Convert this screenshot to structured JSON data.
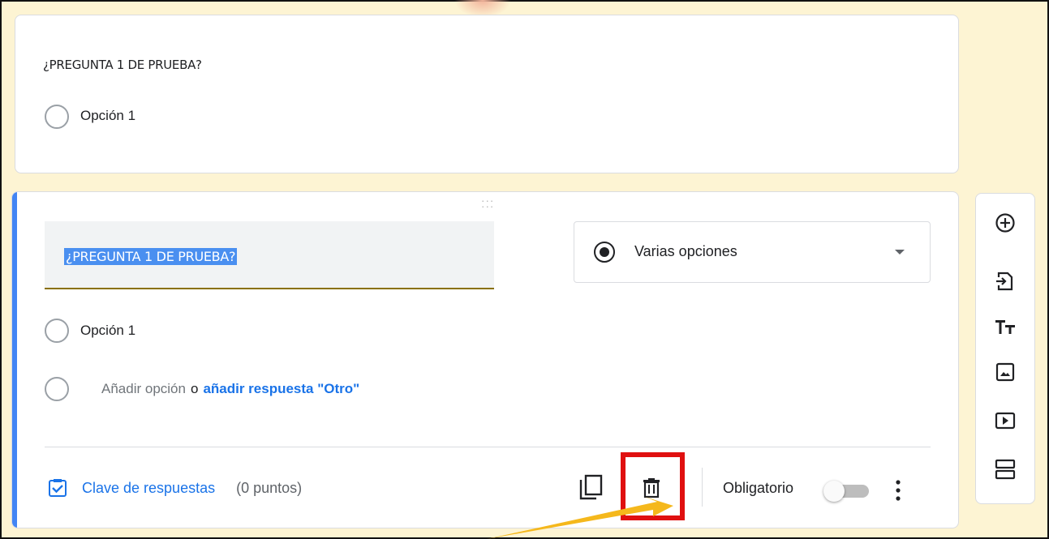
{
  "card1": {
    "question_title": "¿PREGUNTA 1 DE PRUEBA?",
    "option1": "Opción 1"
  },
  "card2": {
    "question_title": "¿PREGUNTA 1 DE PRUEBA?",
    "question_type": "Varias opciones",
    "option1": "Opción 1",
    "add_option": "Añadir opción",
    "or_text": "o",
    "add_other": "añadir respuesta \"Otro\"",
    "answer_key": "Clave de respuestas",
    "points": "(0 puntos)",
    "required_label": "Obligatorio",
    "required_on": false
  },
  "side_toolbar": [
    "add-question-icon",
    "import-questions-icon",
    "add-title-icon",
    "add-image-icon",
    "add-video-icon",
    "add-section-icon"
  ],
  "colors": {
    "accent": "#4285f4",
    "link": "#1a73e8",
    "highlight_box": "#e01010",
    "pointer": "#f5b81c",
    "background": "#fdf4d3"
  }
}
